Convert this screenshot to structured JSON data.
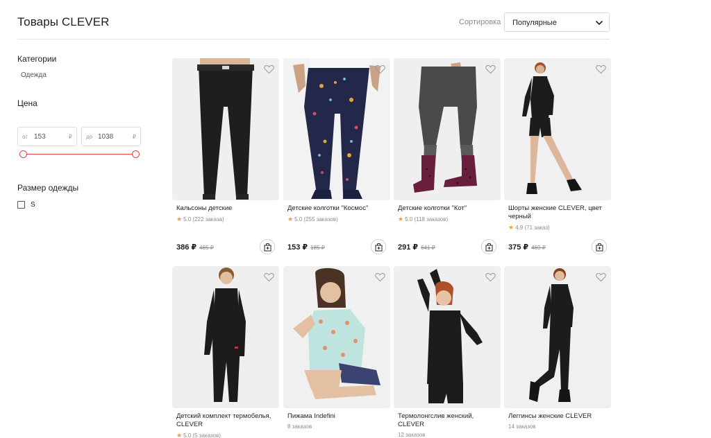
{
  "header": {
    "title": "Товары CLEVER",
    "sort_label": "Сортировка",
    "sort_value": "Популярные"
  },
  "sidebar": {
    "categories_title": "Категории",
    "category_item": "Одежда",
    "price_title": "Цена",
    "price_from_prefix": "от",
    "price_from": "153",
    "price_to_prefix": "до",
    "price_to": "1038",
    "currency": "₽",
    "size_title": "Размер одежды",
    "size_option": "S"
  },
  "products": [
    {
      "name": "Кальсоны детские",
      "rating": "5.0",
      "orders": "(222 заказа)",
      "price": "386 ₽",
      "old_price": "465 ₽"
    },
    {
      "name": "Детские колготки \"Космос\"",
      "rating": "5.0",
      "orders": "(255 заказов)",
      "price": "153 ₽",
      "old_price": "185 ₽"
    },
    {
      "name": "Детские колготки \"Кот\"",
      "rating": "5.0",
      "orders": "(118 заказов)",
      "price": "291 ₽",
      "old_price": "641 ₽"
    },
    {
      "name": "Шорты женские CLEVER, цвет черный",
      "rating": "4.9",
      "orders": "(71 заказ)",
      "price": "375 ₽",
      "old_price": "469 ₽"
    },
    {
      "name": "Детский комплект термобелья, CLEVER",
      "rating": "5.0",
      "orders": "(5 заказов)"
    },
    {
      "name": "Пижама Indefini",
      "orders": "8 заказов"
    },
    {
      "name": "Термолонгслив женский, CLEVER",
      "orders": "12 заказов"
    },
    {
      "name": "Леггинсы женские CLEVER",
      "orders": "14 заказов"
    }
  ],
  "icons": {
    "favorite": "heart-outline-icon",
    "cart": "shopping-bag-add-icon",
    "sort": "chevron-down-icon",
    "rating": "star-icon"
  },
  "colors": {
    "accent": "#e0453f",
    "star": "#f3a21d"
  }
}
